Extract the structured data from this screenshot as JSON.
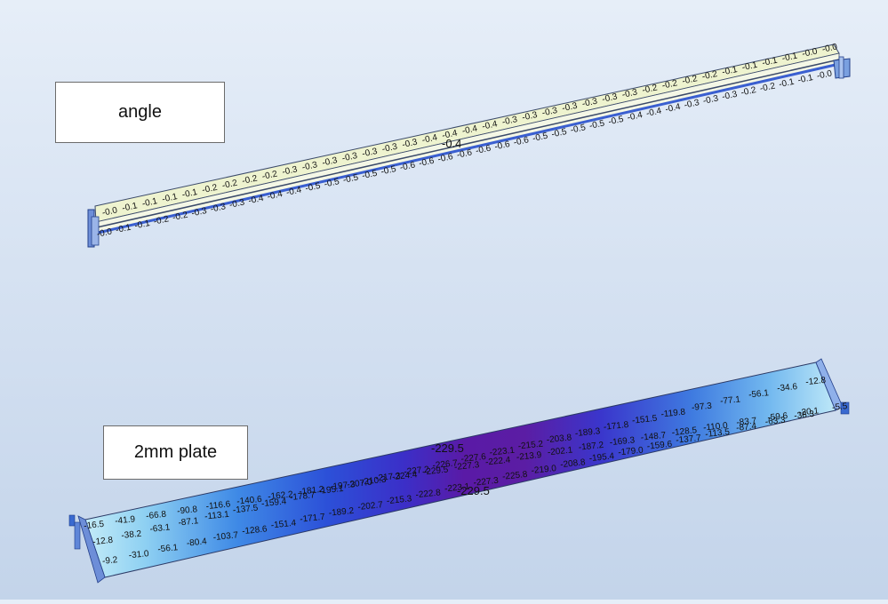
{
  "labels": {
    "angle": "angle",
    "plate": "2mm plate"
  },
  "angle_model": {
    "top_values": [
      "-0.0",
      "-0.1",
      "-0.1",
      "-0.1",
      "-0.1",
      "-0.2",
      "-0.2",
      "-0.2",
      "-0.2",
      "-0.3",
      "-0.3",
      "-0.3",
      "-0.3",
      "-0.3",
      "-0.3",
      "-0.3",
      "-0.4",
      "-0.4",
      "-0.4",
      "-0.4",
      "-0.3",
      "-0.3",
      "-0.3",
      "-0.3",
      "-0.3",
      "-0.3",
      "-0.3",
      "-0.2",
      "-0.2",
      "-0.2",
      "-0.2",
      "-0.1",
      "-0.1",
      "-0.1",
      "-0.1",
      "-0.0",
      "-0.0"
    ],
    "bottom_values": [
      "-0.0",
      "-0.1",
      "-0.1",
      "-0.2",
      "-0.2",
      "-0.3",
      "-0.3",
      "-0.3",
      "-0.4",
      "-0.4",
      "-0.4",
      "-0.5",
      "-0.5",
      "-0.5",
      "-0.5",
      "-0.5",
      "-0.6",
      "-0.6",
      "-0.6",
      "-0.6",
      "-0.6",
      "-0.6",
      "-0.6",
      "-0.5",
      "-0.5",
      "-0.5",
      "-0.5",
      "-0.5",
      "-0.4",
      "-0.4",
      "-0.4",
      "-0.3",
      "-0.3",
      "-0.3",
      "-0.2",
      "-0.2",
      "-0.1",
      "-0.1",
      "-0.0"
    ],
    "mid_label": "-0.4",
    "colors": {
      "face_fill": "#eef3cf",
      "edge": "#3b4a6a",
      "tube": "#3a5fd0",
      "support": "#3a6ad0"
    }
  },
  "plate_model": {
    "row_top": [
      "-16.5",
      "-41.9",
      "-66.8",
      "-90.8",
      "-116.6",
      "-140.6",
      "-162.2",
      "-181.2",
      "-197.3",
      "-210.3",
      "-224.4",
      "-229.5",
      "-227.3",
      "-222.4",
      "-213.9",
      "-202.1",
      "-187.2",
      "-169.3",
      "-148.7",
      "-128.5",
      "-110.0",
      "-83.7",
      "-59.6",
      "-20.1",
      "-5.5"
    ],
    "row_upper": [
      "-12.8",
      "-38.2",
      "-63.1",
      "-87.1",
      "-113.1",
      "-137.5",
      "-159.4",
      "-178.7",
      "-195.1",
      "-207.0",
      "-217.3",
      "-227.2",
      "-226.7",
      "-227.6",
      "-223.1",
      "-215.2",
      "-203.8",
      "-189.3",
      "-171.8",
      "-151.5",
      "-119.8",
      "-97.3",
      "-77.1",
      "-56.1",
      "-34.6",
      "-12.8"
    ],
    "row_lower": [
      "-9.2",
      "-31.0",
      "-56.1",
      "-80.4",
      "-103.7",
      "-128.6",
      "-151.4",
      "-171.7",
      "-189.2",
      "-202.7",
      "-215.3",
      "-222.8",
      "-223.1",
      "-227.3",
      "-225.8",
      "-219.0",
      "-208.8",
      "-195.4",
      "-179.0",
      "-159.6",
      "-137.7",
      "-113.5",
      "-87.4",
      "-63.3",
      "-38.3"
    ],
    "max_label_top": "-229.5",
    "max_label_bottom": "-229.5",
    "colors": {
      "low": "#bde9f8",
      "mid": "#3f7be0",
      "high": "#5a1aa6",
      "peak": "#4a0f8f",
      "edge": "#2c3a66",
      "support": "#3a6ad0"
    }
  }
}
